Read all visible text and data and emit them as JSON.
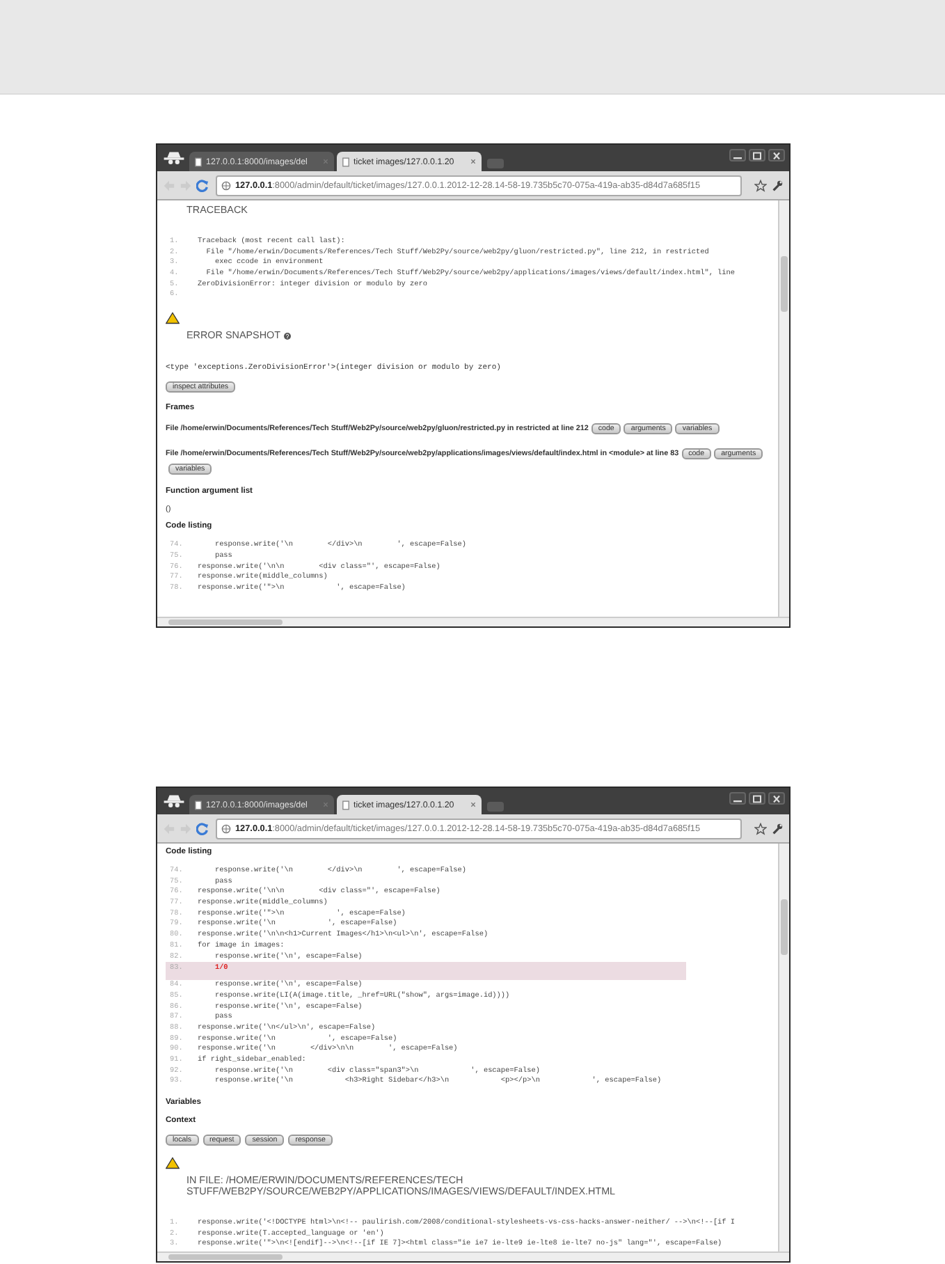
{
  "windows": [
    {
      "tabs": [
        {
          "label": "127.0.0.1:8000/images/del",
          "selected": false
        },
        {
          "label": "ticket images/127.0.0.1.20",
          "selected": true
        }
      ],
      "address": {
        "host": "127.0.0.1",
        "path": ":8000/admin/default/ticket/images/127.0.0.1.2012-12-28.14-58-19.735b5c70-075a-419a-ab35-d84d7a685f15"
      },
      "sections": [
        {
          "kind": "heading",
          "title": "TRACEBACK",
          "warning": false,
          "help": false
        },
        {
          "kind": "code",
          "lines": [
            {
              "number": "1.",
              "text": "Traceback (most recent call last):"
            },
            {
              "number": "2.",
              "text": "  File \"/home/erwin/Documents/References/Tech Stuff/Web2Py/source/web2py/gluon/restricted.py\", line 212, in restricted"
            },
            {
              "number": "3.",
              "text": "    exec ccode in environment"
            },
            {
              "number": "4.",
              "text": "  File \"/home/erwin/Documents/References/Tech Stuff/Web2Py/source/web2py/applications/images/views/default/index.html\", line"
            },
            {
              "number": "5.",
              "text": "ZeroDivisionError: integer division or modulo by zero"
            },
            {
              "number": "6."
            }
          ]
        },
        {
          "kind": "heading",
          "title": "ERROR SNAPSHOT",
          "warning": true,
          "help": true
        },
        {
          "kind": "mono",
          "text": "<type 'exceptions.ZeroDivisionError'>(integer division or modulo by zero)"
        },
        {
          "kind": "buttons",
          "buttons": [
            "inspect attributes"
          ]
        },
        {
          "kind": "subheading",
          "text": "Frames"
        },
        {
          "kind": "frame",
          "text": "File /home/erwin/Documents/References/Tech Stuff/Web2Py/source/web2py/gluon/restricted.py in restricted at line 212",
          "buttons": [
            "code",
            "arguments",
            "variables"
          ]
        },
        {
          "kind": "frame",
          "text": "File /home/erwin/Documents/References/Tech Stuff/Web2Py/source/web2py/applications/images/views/default/index.html in <module> at line 83",
          "buttons": [
            "code",
            "arguments",
            "variables"
          ]
        },
        {
          "kind": "subheading",
          "text": "Function argument list"
        },
        {
          "kind": "text",
          "text": "()"
        },
        {
          "kind": "subheading",
          "text": "Code listing"
        },
        {
          "kind": "code",
          "lines": [
            {
              "number": "74.",
              "text": "    response.write('\\n        </div>\\n        ', escape=False)"
            },
            {
              "number": "75.",
              "text": "    pass"
            },
            {
              "number": "76.",
              "text": "response.write('\\n\\n        <div class=\"', escape=False)"
            },
            {
              "number": "77.",
              "text": "response.write(middle_columns)"
            },
            {
              "number": "78.",
              "text": "response.write('\">\\n            ', escape=False)"
            }
          ]
        }
      ]
    },
    {
      "tabs": [
        {
          "label": "127.0.0.1:8000/images/del",
          "selected": false
        },
        {
          "label": "ticket images/127.0.0.1.20",
          "selected": true
        }
      ],
      "address": {
        "host": "127.0.0.1",
        "path": ":8000/admin/default/ticket/images/127.0.0.1.2012-12-28.14-58-19.735b5c70-075a-419a-ab35-d84d7a685f15"
      },
      "sections": [
        {
          "kind": "subheading",
          "text": "Code listing"
        },
        {
          "kind": "code",
          "lines": [
            {
              "number": "74.",
              "text": "    response.write('\\n        </div>\\n        ', escape=False)",
              "highlighted": false
            },
            {
              "number": "75.",
              "text": "    pass",
              "highlighted": false
            },
            {
              "number": "76.",
              "text": "response.write('\\n\\n        <div class=\"', escape=False)",
              "highlighted": false
            },
            {
              "number": "77.",
              "text": "response.write(middle_columns)",
              "highlighted": false
            },
            {
              "number": "78.",
              "text": "response.write('\">\\n            ', escape=False)",
              "highlighted": false
            },
            {
              "number": "79.",
              "text": "response.write('\\n            ', escape=False)",
              "highlighted": false
            },
            {
              "number": "80.",
              "text": "response.write('\\n\\n<h1>Current Images</h1>\\n<ul>\\n', escape=False)",
              "highlighted": false
            },
            {
              "number": "81.",
              "text": "for image in images:",
              "highlighted": false
            },
            {
              "number": "82.",
              "text": "    response.write('\\n', escape=False)",
              "highlighted": false
            },
            {
              "number": "83.",
              "text": "    1/0",
              "highlighted": true
            },
            {
              "number": "84.",
              "text": "    response.write('\\n', escape=False)",
              "highlighted": false
            },
            {
              "number": "85.",
              "text": "    response.write(LI(A(image.title, _href=URL(\"show\", args=image.id))))",
              "highlighted": false
            },
            {
              "number": "86.",
              "text": "    response.write('\\n', escape=False)",
              "highlighted": false
            },
            {
              "number": "87.",
              "text": "    pass",
              "highlighted": false
            },
            {
              "number": "88.",
              "text": "response.write('\\n</ul>\\n', escape=False)",
              "highlighted": false
            },
            {
              "number": "89.",
              "text": "response.write('\\n            ', escape=False)",
              "highlighted": false
            },
            {
              "number": "90.",
              "text": "response.write('\\n        </div>\\n\\n        ', escape=False)",
              "highlighted": false
            },
            {
              "number": "91.",
              "text": "if right_sidebar_enabled:",
              "highlighted": false
            },
            {
              "number": "92.",
              "text": "    response.write('\\n        <div class=\"span3\">\\n            ', escape=False)",
              "highlighted": false
            },
            {
              "number": "93.",
              "text": "    response.write('\\n            <h3>Right Sidebar</h3>\\n            <p></p>\\n            ', escape=False)",
              "highlighted": false
            }
          ]
        },
        {
          "kind": "subheading",
          "text": "Variables"
        },
        {
          "kind": "subheading",
          "text": "Context"
        },
        {
          "kind": "buttons",
          "buttons": [
            "locals",
            "request",
            "session",
            "response"
          ]
        },
        {
          "kind": "heading",
          "title": "IN FILE: /HOME/ERWIN/DOCUMENTS/REFERENCES/TECH STUFF/WEB2PY/SOURCE/WEB2PY/APPLICATIONS/IMAGES/VIEWS/DEFAULT/INDEX.HTML",
          "warning": true,
          "help": false
        },
        {
          "kind": "code",
          "lines": [
            {
              "number": "1.",
              "text": "response.write('<!DOCTYPE html>\\n<!-- paulirish.com/2008/conditional-stylesheets-vs-css-hacks-answer-neither/ -->\\n<!--[if I"
            },
            {
              "number": "2.",
              "text": "response.write(T.accepted_language or 'en')"
            },
            {
              "number": "3.",
              "text": "response.write('\">\\n<![endif]-->\\n<!--[if IE 7]><html class=\"ie ie7 ie-lte9 ie-lte8 ie-lte7 no-js\" lang=\"', escape=False)"
            }
          ]
        }
      ]
    }
  ]
}
